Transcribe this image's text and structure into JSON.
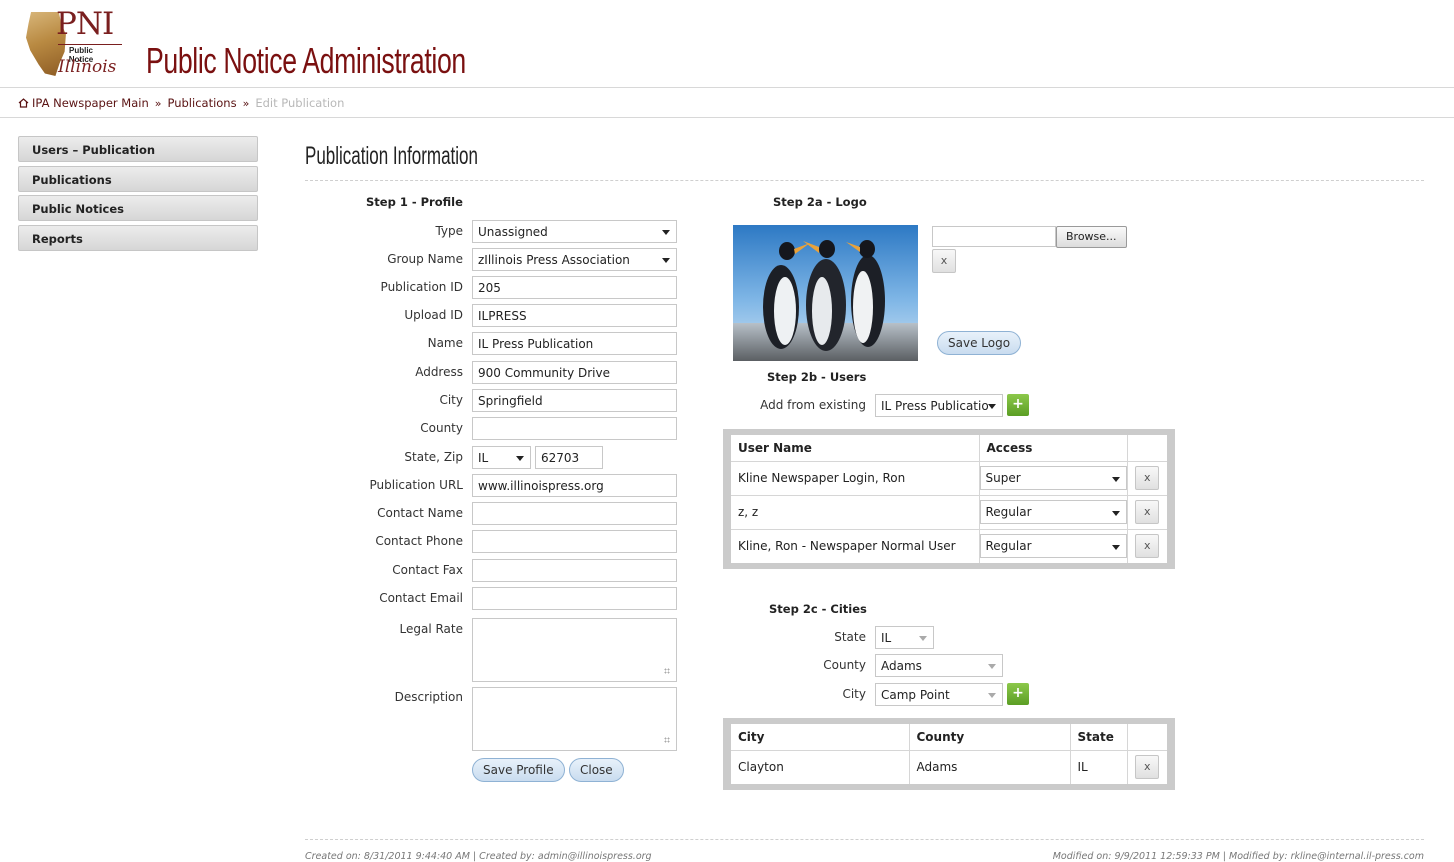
{
  "header": {
    "logo_text": "PNI",
    "logo_sub": "Public Notice",
    "logo_state": "Illinois",
    "title": "Public Notice Administration"
  },
  "breadcrumb": {
    "home": "IPA Newspaper Main",
    "publications": "Publications",
    "current": "Edit Publication"
  },
  "sidebar": {
    "items": [
      {
        "label": "Users – Publication"
      },
      {
        "label": "Publications"
      },
      {
        "label": "Public Notices"
      },
      {
        "label": "Reports"
      }
    ]
  },
  "page": {
    "title": "Publication Information"
  },
  "profile": {
    "step_title": "Step 1 - Profile",
    "type_label": "Type",
    "type_value": "Unassigned",
    "group_label": "Group Name",
    "group_value": "zIllinois Press Association",
    "pubid_label": "Publication ID",
    "pubid_value": "205",
    "uploadid_label": "Upload ID",
    "uploadid_value": "ILPRESS",
    "name_label": "Name",
    "name_value": "IL Press Publication",
    "address_label": "Address",
    "address_value": "900 Community Drive",
    "city_label": "City",
    "city_value": "Springfield",
    "county_label": "County",
    "county_value": "",
    "statezip_label": "State, Zip",
    "state_value": "IL",
    "zip_value": "62703",
    "url_label": "Publication URL",
    "url_value": "www.illinoispress.org",
    "contact_name_label": "Contact Name",
    "contact_name_value": "",
    "contact_phone_label": "Contact Phone",
    "contact_phone_value": "",
    "contact_fax_label": "Contact Fax",
    "contact_fax_value": "",
    "contact_email_label": "Contact Email",
    "contact_email_value": "",
    "legal_rate_label": "Legal Rate",
    "legal_rate_value": "",
    "description_label": "Description",
    "description_value": "",
    "save_label": "Save Profile",
    "close_label": "Close"
  },
  "logo_step": {
    "step_title": "Step 2a - Logo",
    "file_value": "",
    "browse_label": "Browse...",
    "remove_label": "x",
    "save_label": "Save Logo"
  },
  "users_step": {
    "step_title": "Step 2b - Users",
    "add_label": "Add from existing",
    "add_value": "IL Press Publicatio",
    "add_button": "+",
    "columns": [
      "User Name",
      "Access"
    ],
    "rows": [
      {
        "name": "Kline Newspaper Login, Ron",
        "access": "Super",
        "remove": "x"
      },
      {
        "name": "z, z",
        "access": "Regular",
        "remove": "x"
      },
      {
        "name": "Kline, Ron - Newspaper Normal User",
        "access": "Regular",
        "remove": "x"
      }
    ]
  },
  "cities_step": {
    "step_title": "Step 2c - Cities",
    "state_label": "State",
    "state_value": "IL",
    "county_label": "County",
    "county_value": "Adams",
    "city_label": "City",
    "city_value": "Camp Point",
    "add_button": "+",
    "columns": [
      "City",
      "County",
      "State"
    ],
    "rows": [
      {
        "city": "Clayton",
        "county": "Adams",
        "state": "IL",
        "remove": "x"
      }
    ]
  },
  "footer": {
    "created": "Created on: 8/31/2011 9:44:40 AM | Created by: admin@illinoispress.org",
    "modified": "Modified on: 9/9/2011 12:59:33 PM | Modified by: rkline@internal.il-press.com"
  },
  "colors": {
    "brand": "#7a1010",
    "breadcrumb": "#5a1313",
    "pill": "#c9dcef",
    "add_green": "#5b9e24",
    "table_frame": "#cbcbcb"
  },
  "icons": [
    "home-icon",
    "caret-down-icon",
    "plus-icon",
    "close-icon",
    "resize-grip-icon"
  ]
}
